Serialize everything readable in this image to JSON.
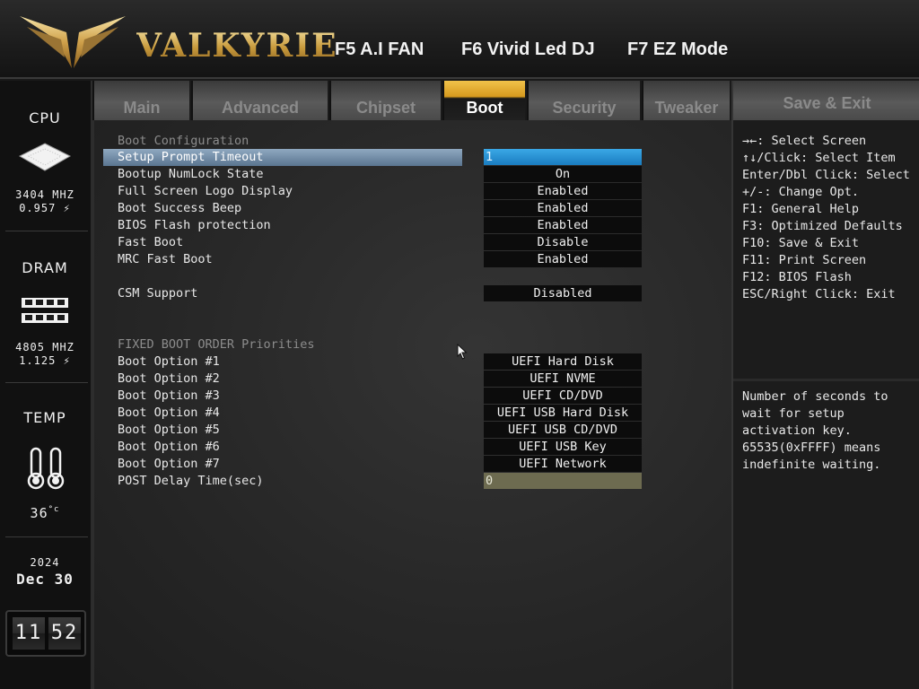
{
  "header": {
    "brand": "VALKYRIE",
    "hotkeys": [
      "F5 A.I FAN",
      "F6 Vivid Led DJ",
      "F7 EZ Mode"
    ]
  },
  "status": {
    "cpu_title": "CPU",
    "cpu_freq": "3404 MHZ",
    "cpu_volt": "0.957",
    "dram_title": "DRAM",
    "dram_freq": "4805 MHZ",
    "dram_volt": "1.125",
    "temp_title": "TEMP",
    "temp_value": "36",
    "year": "2024",
    "month": "Dec",
    "day": "30",
    "time_h": "11",
    "time_m": "52"
  },
  "tabs": [
    "Main",
    "Advanced",
    "Chipset",
    "Boot",
    "Security",
    "Tweaker",
    "Save & Exit"
  ],
  "active_tab": "Boot",
  "settings": {
    "boot_config": "Boot Configuration",
    "setup_prompt_timeout": {
      "label": "Setup Prompt Timeout",
      "value": "1"
    },
    "numlock": {
      "label": "Bootup NumLock State",
      "value": "On"
    },
    "logo_display": {
      "label": "Full Screen Logo Display",
      "value": "Enabled"
    },
    "success_beep": {
      "label": "Boot Success Beep",
      "value": "Enabled"
    },
    "flash_protection": {
      "label": "BIOS Flash protection",
      "value": "Enabled"
    },
    "fast_boot": {
      "label": "Fast Boot",
      "value": "Disable"
    },
    "mrc_fast_boot": {
      "label": "MRC Fast Boot",
      "value": "Enabled"
    },
    "csm_support": {
      "label": "CSM Support",
      "value": "Disabled"
    },
    "fixed_order": "FIXED BOOT ORDER Priorities",
    "boot_options": [
      {
        "label": "Boot Option #1",
        "value": "UEFI Hard Disk"
      },
      {
        "label": "Boot Option #2",
        "value": "UEFI NVME"
      },
      {
        "label": "Boot Option #3",
        "value": "UEFI CD/DVD"
      },
      {
        "label": "Boot Option #4",
        "value": "UEFI USB Hard Disk"
      },
      {
        "label": "Boot Option #5",
        "value": "UEFI USB CD/DVD"
      },
      {
        "label": "Boot Option #6",
        "value": "UEFI USB Key"
      },
      {
        "label": "Boot Option #7",
        "value": "UEFI Network"
      }
    ],
    "post_delay": {
      "label": "POST Delay Time(sec)",
      "value": "0"
    }
  },
  "help": {
    "keys": [
      "→←: Select Screen",
      "↑↓/Click: Select Item",
      "Enter/Dbl Click: Select",
      "+/-: Change Opt.",
      "F1: General Help",
      "F3: Optimized Defaults",
      "F10: Save & Exit",
      "F11: Print Screen",
      "F12: BIOS Flash",
      "ESC/Right Click: Exit"
    ],
    "description": [
      "Number of seconds to",
      "wait for setup",
      "activation key.",
      "65535(0xFFFF) means",
      "indefinite waiting."
    ]
  },
  "colors": {
    "accent_gold": "#d69a1e",
    "selected_value_blue": "#1a7cc0",
    "editing_value_olive": "#6d6b50"
  }
}
